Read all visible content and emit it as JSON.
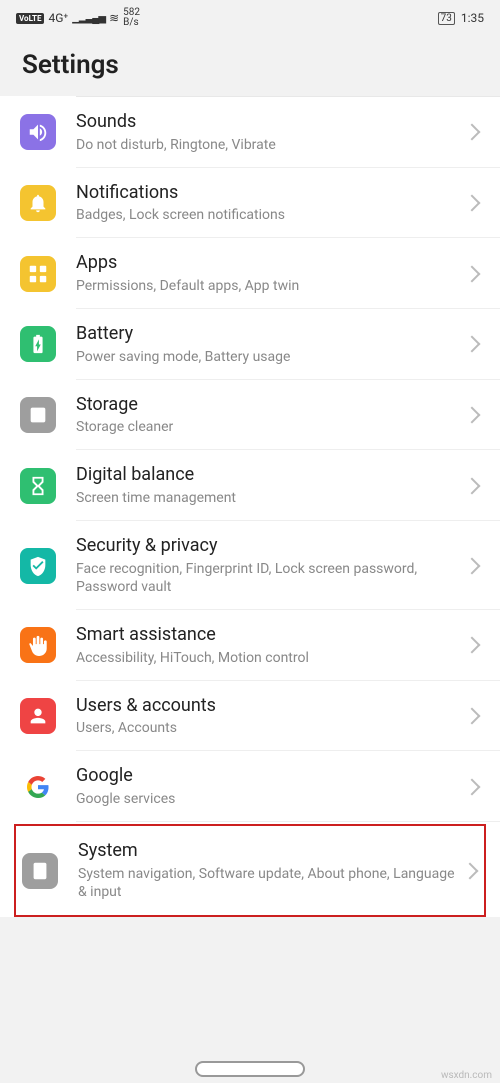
{
  "status": {
    "volte": "VoLTE",
    "net": "4G⁺",
    "signal": "▁▂▃▄▅",
    "wifi": "≋",
    "speed_top": "582",
    "speed_bot": "B/s",
    "battery": "73",
    "time": "1:35"
  },
  "header": {
    "title": "Settings"
  },
  "items": {
    "sounds": {
      "title": "Sounds",
      "desc": "Do not disturb, Ringtone, Vibrate",
      "color": "#8b72e6"
    },
    "notif": {
      "title": "Notifications",
      "desc": "Badges, Lock screen notifications",
      "color": "#f4c430"
    },
    "apps": {
      "title": "Apps",
      "desc": "Permissions, Default apps, App twin",
      "color": "#f4c430"
    },
    "battery": {
      "title": "Battery",
      "desc": "Power saving mode, Battery usage",
      "color": "#2fbf71"
    },
    "storage": {
      "title": "Storage",
      "desc": "Storage cleaner",
      "color": "#9e9e9e"
    },
    "digital": {
      "title": "Digital balance",
      "desc": "Screen time management",
      "color": "#2fbf71"
    },
    "security": {
      "title": "Security & privacy",
      "desc": "Face recognition, Fingerprint ID, Lock screen password, Password vault",
      "color": "#14b8a6"
    },
    "smart": {
      "title": "Smart assistance",
      "desc": "Accessibility, HiTouch, Motion control",
      "color": "#f97316"
    },
    "users": {
      "title": "Users & accounts",
      "desc": "Users, Accounts",
      "color": "#ef4444"
    },
    "google": {
      "title": "Google",
      "desc": "Google services"
    },
    "system": {
      "title": "System",
      "desc": "System navigation, Software update, About phone, Language & input",
      "color": "#9e9e9e"
    }
  },
  "watermark": "wsxdn.com"
}
